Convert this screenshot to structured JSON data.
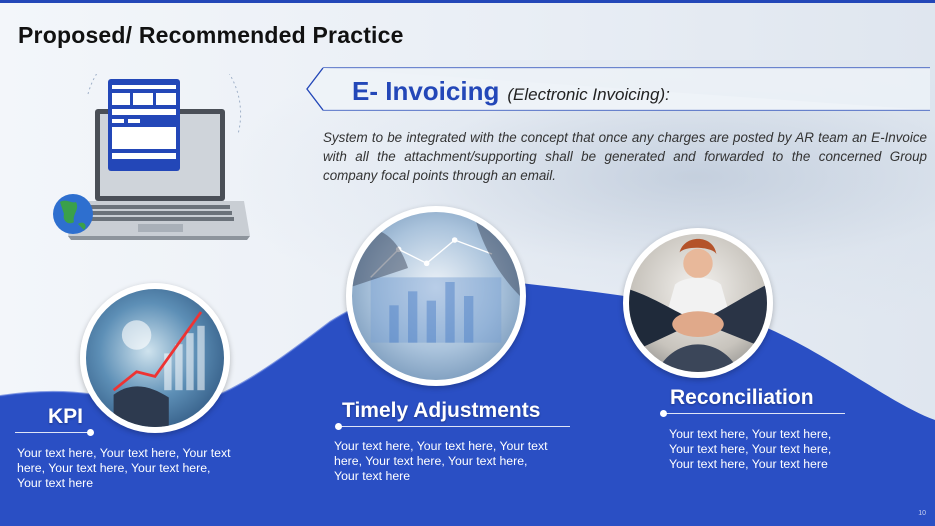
{
  "slide": {
    "title": "Proposed/ Recommended Practice",
    "page_number": "10"
  },
  "einvoice": {
    "heading": "E- Invoicing",
    "subheading": "(Electronic Invoicing):",
    "description": "System to be integrated with the concept that once any charges are posted by AR team an E-Invoice with all the attachment/supporting shall be generated and forwarded to the concerned Group company focal points through an email."
  },
  "sections": [
    {
      "title": "KPI",
      "body": "Your text here, Your text here, Your text here, Your text here, Your text here, Your text here",
      "image_icon": "kpi-chart-photo"
    },
    {
      "title": "Timely Adjustments",
      "body": "Your text here, Your text here, Your text here, Your text here, Your text here, Your text here",
      "image_icon": "meeting-photo"
    },
    {
      "title": "Reconciliation",
      "body": "Your text here, Your text here, Your text here, Your text here, Your text here, Your text here",
      "image_icon": "team-hands-photo"
    }
  ],
  "colors": {
    "accent": "#2347b8",
    "wave": "#2a4fc4",
    "text": "#111111"
  }
}
